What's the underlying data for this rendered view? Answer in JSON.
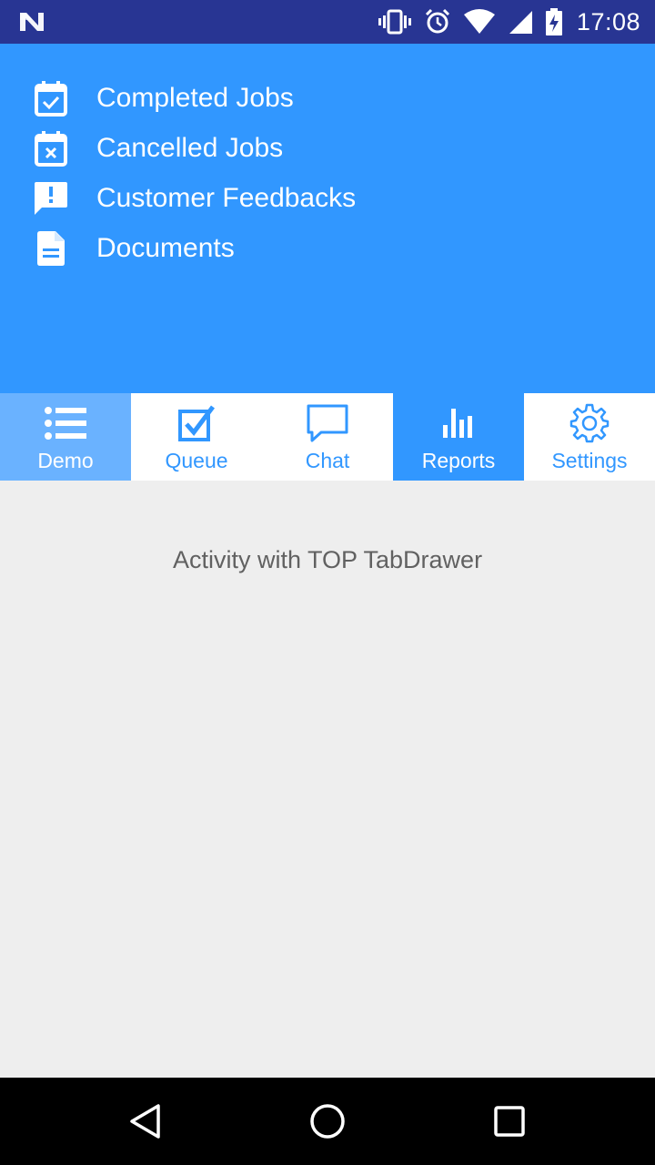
{
  "status_bar": {
    "time": "17:08",
    "icons": [
      "n-logo-icon",
      "vibrate-icon",
      "alarm-icon",
      "wifi-icon",
      "signal-icon",
      "battery-charging-icon"
    ]
  },
  "drawer": {
    "items": [
      {
        "label": "Completed Jobs",
        "icon": "calendar-check-icon"
      },
      {
        "label": "Cancelled Jobs",
        "icon": "calendar-remove-icon"
      },
      {
        "label": "Customer Feedbacks",
        "icon": "feedback-icon"
      },
      {
        "label": "Documents",
        "icon": "document-icon"
      }
    ]
  },
  "tabs": [
    {
      "label": "Demo",
      "icon": "list-icon",
      "state": "selected"
    },
    {
      "label": "Queue",
      "icon": "checkbox-icon"
    },
    {
      "label": "Chat",
      "icon": "chat-bubble-icon"
    },
    {
      "label": "Reports",
      "icon": "bar-chart-icon",
      "state": "highlighted"
    },
    {
      "label": "Settings",
      "icon": "gear-icon"
    }
  ],
  "content": {
    "message": "Activity with TOP TabDrawer"
  },
  "nav_bar": {
    "buttons": [
      "back-icon",
      "home-icon",
      "recents-icon"
    ]
  },
  "colors": {
    "status_bar": "#283593",
    "accent": "#3197ff",
    "tab_selected": "#6ab2ff",
    "background": "#eeeeee"
  }
}
